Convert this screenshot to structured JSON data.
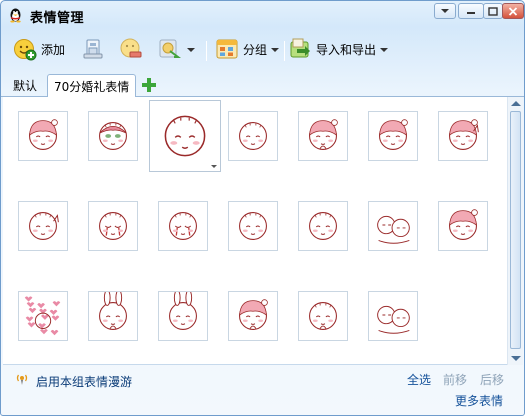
{
  "window": {
    "title": "表情管理"
  },
  "toolbar": {
    "add_label": "添加",
    "group_label": "分组",
    "import_export_label": "导入和导出"
  },
  "tabs": [
    {
      "label": "默认"
    },
    {
      "label": "70分婚礼表情"
    }
  ],
  "emoticons": [
    {
      "kind": "pink-hat-sleepy"
    },
    {
      "kind": "green-eyes-girl"
    },
    {
      "kind": "bald-boy-blush",
      "selected": true
    },
    {
      "kind": "bald-boy-smile"
    },
    {
      "kind": "pink-hat-finger"
    },
    {
      "kind": "pink-hat-happy"
    },
    {
      "kind": "pink-hat-girl"
    },
    {
      "kind": "bald-boy-lying"
    },
    {
      "kind": "bald-boy-cry"
    },
    {
      "kind": "bald-boy-sob"
    },
    {
      "kind": "bald-boy-sit"
    },
    {
      "kind": "bald-boy-hug"
    },
    {
      "kind": "couple-hug"
    },
    {
      "kind": "pink-hat-shout"
    },
    {
      "kind": "pink-hearts"
    },
    {
      "kind": "bunny-girl-eat"
    },
    {
      "kind": "bunny-girl-bowl"
    },
    {
      "kind": "pink-hat-eat"
    },
    {
      "kind": "bald-boy-hands"
    },
    {
      "kind": "sketch-couple"
    }
  ],
  "footer": {
    "roam_label": "启用本组表情漫游",
    "select_all": "全选",
    "move_forward": "前移",
    "move_backward": "后移",
    "more_label": "更多表情"
  },
  "colors": {
    "link": "#15529a",
    "disabled_link": "#8fa4b8",
    "line_art": "#9a2a2a",
    "pink_hat": "#f2a9b4"
  }
}
